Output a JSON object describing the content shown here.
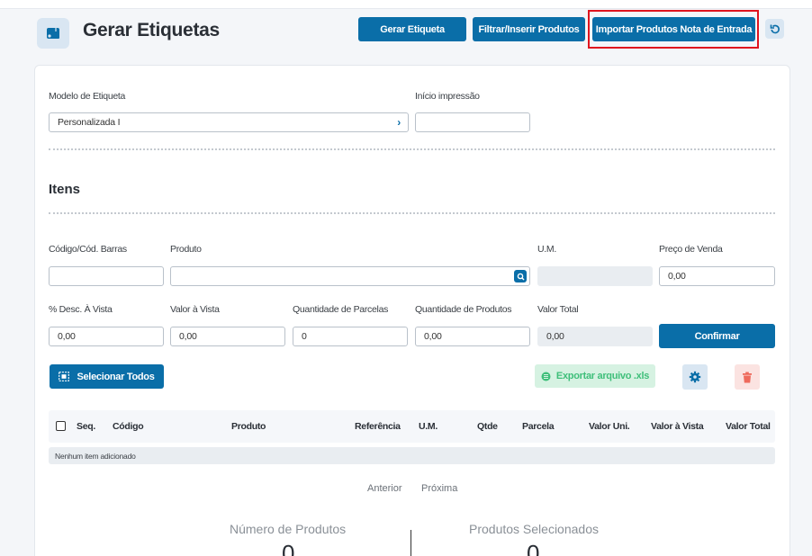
{
  "header": {
    "title": "Gerar Etiquetas",
    "btn_gerar": "Gerar Etiqueta",
    "btn_filtrar": "Filtrar/Inserir Produtos",
    "btn_importar": "Importar Produtos Nota de Entrada",
    "accent_color": "#0a6ea8",
    "highlight_color": "#e0141e"
  },
  "form": {
    "modelo_label": "Modelo de Etiqueta",
    "modelo_value": "Personalizada I",
    "inicio_label": "Início impressão",
    "inicio_value": ""
  },
  "itens": {
    "title": "Itens",
    "codigo_label": "Código/Cód. Barras",
    "produto_label": "Produto",
    "um_label": "U.M.",
    "preco_label": "Preço de Venda",
    "preco_value": "0,00",
    "desc_label": "% Desc. À Vista",
    "desc_value": "0,00",
    "valor_vista_label": "Valor à Vista",
    "valor_vista_value": "0,00",
    "qtd_parcelas_label": "Quantidade de Parcelas",
    "qtd_parcelas_value": "0",
    "qtd_produtos_label": "Quantidade de Produtos",
    "qtd_produtos_value": "0,00",
    "valor_total_label": "Valor Total",
    "valor_total_value": "0,00",
    "confirmar": "Confirmar",
    "selecionar_todos": "Selecionar Todos",
    "exportar": "Exportar arquivo .xls"
  },
  "table": {
    "columns": [
      "Seq.",
      "Código",
      "Produto",
      "Referência",
      "U.M.",
      "Qtde",
      "Parcela",
      "Valor Uni.",
      "Valor à Vista",
      "Valor Total"
    ],
    "empty": "Nenhum item adicionado"
  },
  "pager": {
    "prev": "Anterior",
    "next": "Próxima"
  },
  "stats": {
    "num_produtos_label": "Número de Produtos",
    "num_produtos_value": "0",
    "selecionados_label": "Produtos Selecionados",
    "selecionados_value": "0"
  }
}
